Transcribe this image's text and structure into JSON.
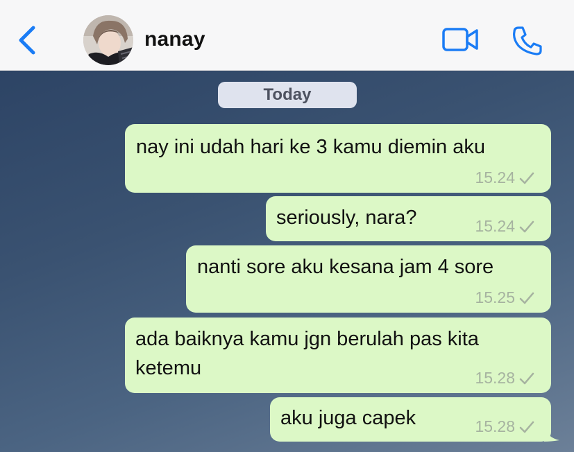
{
  "header": {
    "contact_name": "nanay",
    "back_icon": "chevron-left-icon",
    "video_icon": "video-camera-icon",
    "call_icon": "phone-icon",
    "accent_color": "#1a7cf5"
  },
  "chat": {
    "date_label": "Today",
    "bubble_color": "#dcf8c6",
    "messages": [
      {
        "text": "nay ini udah hari ke 3 kamu diemin aku",
        "time": "15.24",
        "status_icon": "check-icon"
      },
      {
        "text": "seriously, nara?",
        "time": "15.24",
        "status_icon": "check-icon"
      },
      {
        "text": "nanti sore aku kesana jam 4 sore",
        "time": "15.25",
        "status_icon": "check-icon"
      },
      {
        "text_line1": "ada baiknya kamu jgn berulah pas kita",
        "text_line2": "ketemu",
        "time": "15.28",
        "status_icon": "check-icon"
      },
      {
        "text": "aku juga capek",
        "time": "15.28",
        "status_icon": "check-icon"
      }
    ]
  }
}
